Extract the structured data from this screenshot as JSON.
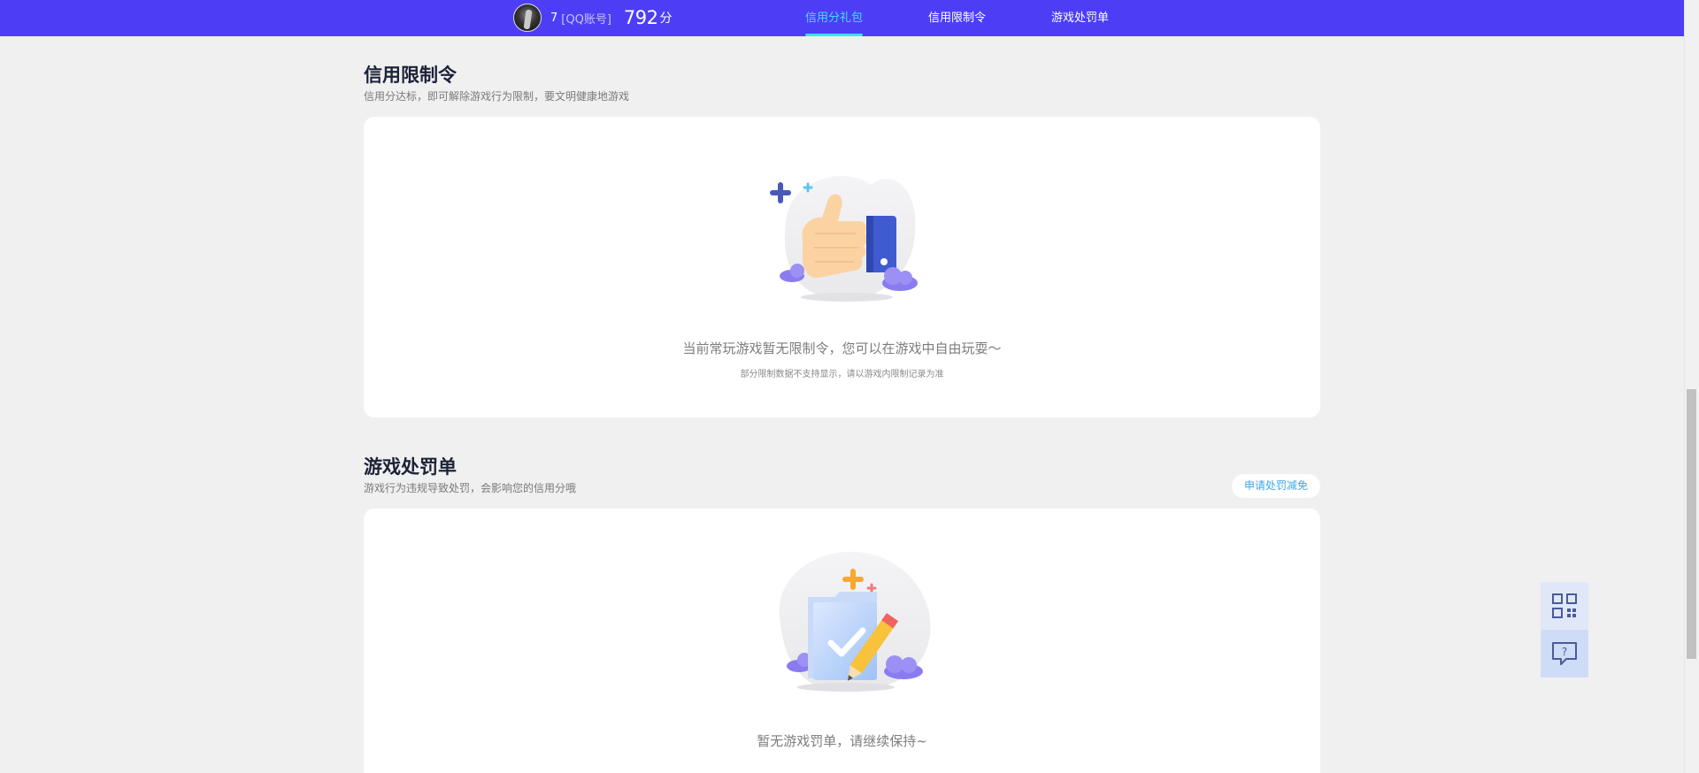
{
  "header": {
    "user_id": "7",
    "account_type": "[QQ账号]",
    "score": "792",
    "score_unit": "分",
    "nav": [
      {
        "label": "信用分礼包",
        "active": true
      },
      {
        "label": "信用限制令",
        "active": false
      },
      {
        "label": "游戏处罚单",
        "active": false
      }
    ]
  },
  "restriction": {
    "title": "信用限制令",
    "subtitle": "信用分达标，即可解除游戏行为限制，要文明健康地游戏",
    "empty_text": "当前常玩游戏暂无限制令，您可以在游戏中自由玩耍～",
    "empty_note": "部分限制数据不支持显示，请以游戏内限制记录为准",
    "illustration_icon": "thumbs-up-icon"
  },
  "penalty": {
    "title": "游戏处罚单",
    "subtitle": "游戏行为违规导致处罚，会影响您的信用分哦",
    "appeal_button": "申请处罚减免",
    "empty_text": "暂无游戏罚单，请继续保持~",
    "illustration_icon": "document-check-icon"
  },
  "side_tools": [
    {
      "icon": "qr-code-icon"
    },
    {
      "icon": "help-chat-icon"
    }
  ],
  "colors": {
    "header_bg": "#4d3ef6",
    "nav_active": "#3fe0ff",
    "page_bg": "#f0f0f0",
    "appeal_text": "#3aa8e8"
  }
}
